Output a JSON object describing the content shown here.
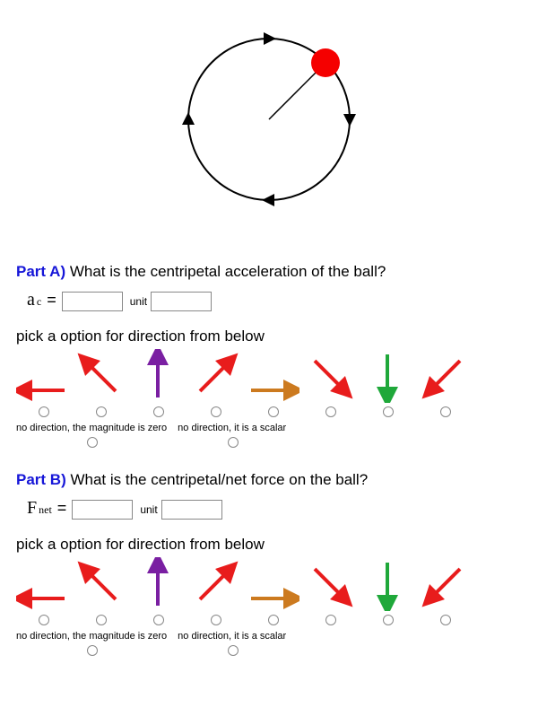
{
  "diagram": {
    "alt": "Ball on circular path with radius line, clockwise motion arrows"
  },
  "partA": {
    "label": "Part A)",
    "question": "What is the centripetal acceleration of the ball?",
    "symbol": "a",
    "subscript": "c",
    "equals": "=",
    "value": "",
    "unit_label": "unit",
    "unit_value": "",
    "dir_prompt": "pick a option for direction from below",
    "text_option_1": "no direction, the magnitude is zero",
    "text_option_2": "no direction, it is a scalar"
  },
  "partB": {
    "label": "Part B)",
    "question": "What is the centripetal/net force on the ball?",
    "symbol": "F",
    "subscript": "net",
    "equals": "=",
    "value": "",
    "unit_label": "unit",
    "unit_value": "",
    "dir_prompt": "pick a option for direction from below",
    "text_option_1": "no direction, the magnitude is zero",
    "text_option_2": "no direction, it is a scalar"
  },
  "arrows": [
    {
      "name": "left",
      "color": "#e81c1c",
      "tall": false
    },
    {
      "name": "up-left",
      "color": "#e81c1c",
      "tall": true
    },
    {
      "name": "up",
      "color": "#7a1fa2",
      "tall": true
    },
    {
      "name": "up-right",
      "color": "#e81c1c",
      "tall": true
    },
    {
      "name": "right",
      "color": "#cc7a1f",
      "tall": false
    },
    {
      "name": "down-right",
      "color": "#e81c1c",
      "tall": true
    },
    {
      "name": "down",
      "color": "#1fa83a",
      "tall": true
    },
    {
      "name": "down-left",
      "color": "#e81c1c",
      "tall": true
    }
  ]
}
